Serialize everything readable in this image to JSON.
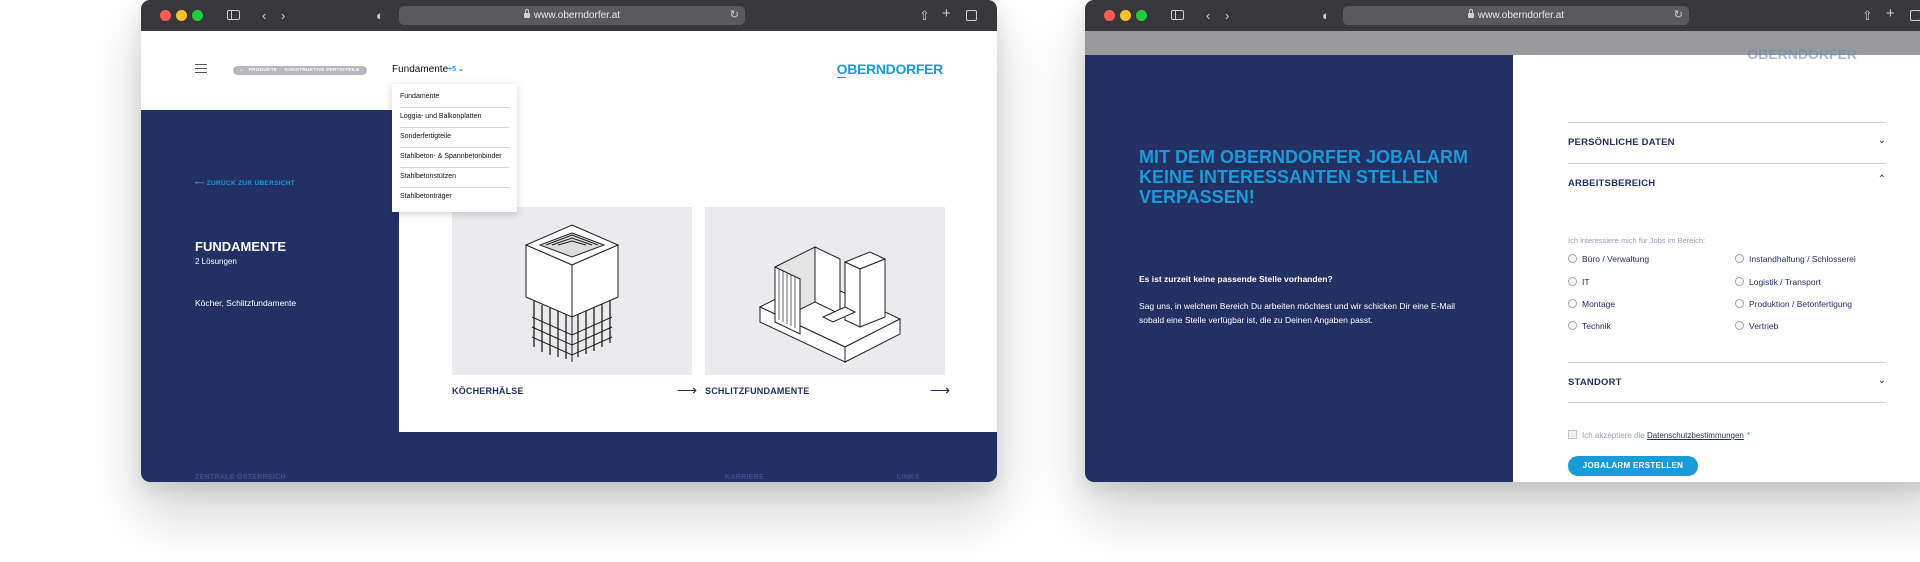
{
  "window1": {
    "url": "www.oberndorfer.at",
    "breadcrumb": [
      "PRODUKTE",
      "KONSTRUKTIVE FERTIGTEILE"
    ],
    "nav_title": "Fundamente",
    "nav_count": "+5",
    "logo": "OBERNDORFER",
    "dropdown": [
      "Fundamente",
      "Loggia- und Balkonplatten",
      "Sonderfertigteile",
      "Stahlbeton- & Spannbetonbinder",
      "Stahlbetonstützen",
      "Stahlbetonträger"
    ],
    "back_link": "ZURÜCK ZUR ÜBERSICHT",
    "panel_title": "FUNDAMENTE",
    "panel_sub": "2 Lösungen",
    "panel_desc": "Köcher, Schlitzfundamente",
    "cards": [
      {
        "label": "KÖCHERHÄLSE",
        "illustration": "koecherhals-drawing"
      },
      {
        "label": "SCHLITZFUNDAMENTE",
        "illustration": "schlitzfundament-drawing"
      }
    ],
    "footer_links": [
      "ZENTRALE ÖSTERREICH",
      "KARRIERE",
      "LINKS"
    ]
  },
  "window2": {
    "url": "www.oberndorfer.at",
    "headline": "MIT DEM OBERNDORFER JOBALARM KEINE INTERESSANTEN STELLEN VERPASSEN!",
    "question": "Es ist zurzeit keine passende Stelle vorhanden?",
    "paragraph": "Sag uns, in welchem Bereich Du arbeiten möchtest und wir schicken Dir eine E-Mail sobald eine Stelle verfügbar ist, die zu Deinen Angaben passt.",
    "sections": {
      "personal": "PERSÖNLICHE DATEN",
      "work_area": "ARBEITSBEREICH",
      "location": "STANDORT"
    },
    "work_hint": "Ich interessiere mich für Jobs im Bereich:",
    "options_left": [
      "Büro / Verwaltung",
      "IT",
      "Montage",
      "Technik"
    ],
    "options_right": [
      "Instandhaltung / Schlosserei",
      "Logistik / Transport",
      "Produktion / Betonfertigung",
      "Vertrieb"
    ],
    "consent_prefix": "Ich akzeptiere die",
    "consent_link": "Datenschutzbestimmungen",
    "consent_star": "*",
    "cta": "JOBALARM ERSTELLEN"
  },
  "colors": {
    "navy": "#233064",
    "accent": "#1a9ad6",
    "card_bg": "#ebebed"
  }
}
